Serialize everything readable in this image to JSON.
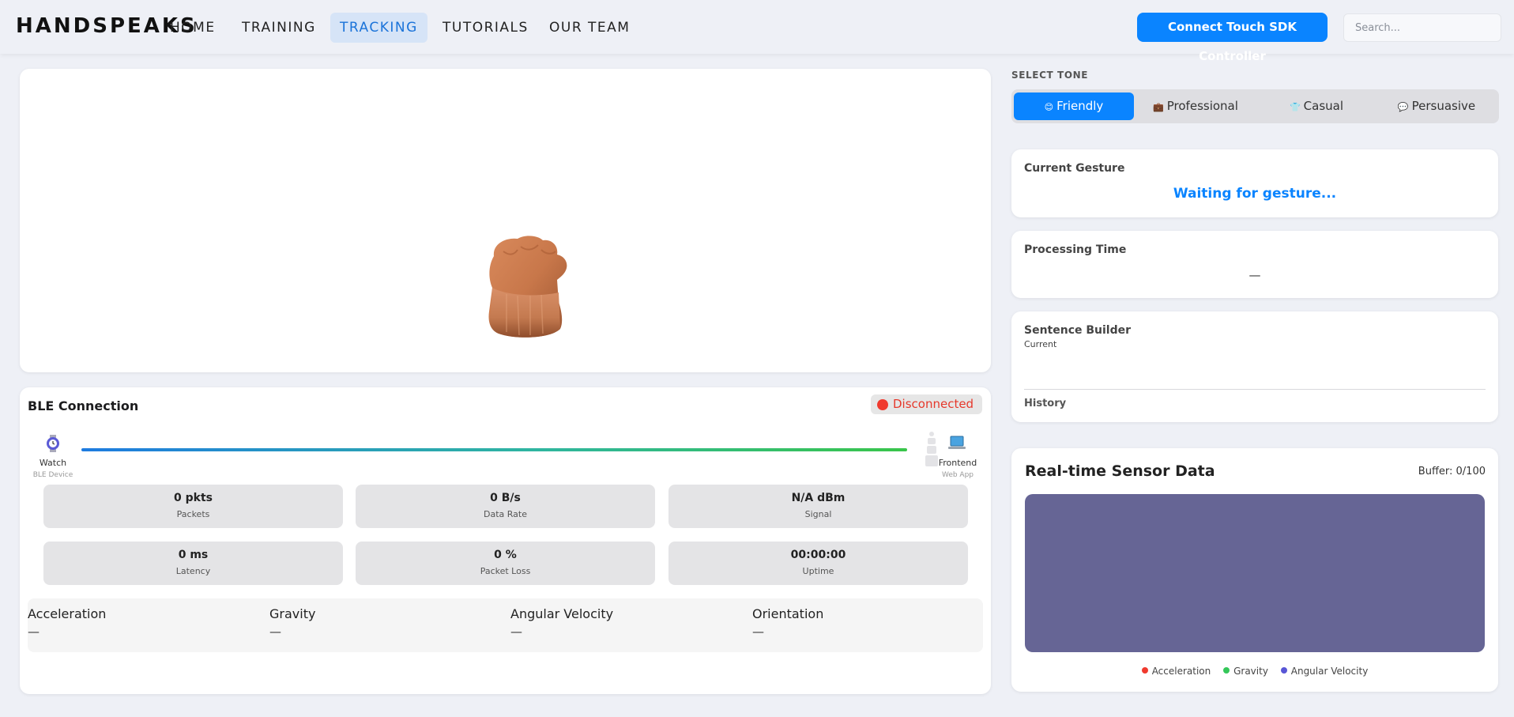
{
  "nav": {
    "brand": "HANDSPEAKS",
    "links": [
      "HOME",
      "TRAINING",
      "TRACKING",
      "TUTORIALS",
      "OUR TEAM"
    ],
    "active_link": "TRACKING",
    "connect_label": "Connect Touch SDK Controller",
    "search_placeholder": "Search..."
  },
  "ble": {
    "title": "BLE Connection",
    "status": "Disconnected",
    "status_color": "#f03a2e",
    "watch": {
      "label": "Watch",
      "sub": "BLE Device",
      "icon": "watch-icon"
    },
    "frontend": {
      "label": "Frontend",
      "sub": "Web App",
      "icon": "laptop-icon"
    },
    "stats": [
      {
        "value": "0 pkts",
        "label": "Packets"
      },
      {
        "value": "0 B/s",
        "label": "Data Rate"
      },
      {
        "value": "N/A dBm",
        "label": "Signal"
      },
      {
        "value": "0 ms",
        "label": "Latency"
      },
      {
        "value": "0 %",
        "label": "Packet Loss"
      },
      {
        "value": "00:00:00",
        "label": "Uptime"
      }
    ],
    "motion": [
      {
        "name": "Acceleration",
        "value": "—"
      },
      {
        "name": "Gravity",
        "value": "—"
      },
      {
        "name": "Angular Velocity",
        "value": "—"
      },
      {
        "name": "Orientation",
        "value": "—"
      }
    ]
  },
  "tone": {
    "label": "SELECT TONE",
    "options": [
      {
        "label": "Friendly",
        "icon": "😊"
      },
      {
        "label": "Professional",
        "icon": "💼"
      },
      {
        "label": "Casual",
        "icon": "👕"
      },
      {
        "label": "Persuasive",
        "icon": "💬"
      }
    ],
    "selected": "Friendly",
    "accent": "#0a84ff"
  },
  "gesture": {
    "title": "Current Gesture",
    "status": "Waiting for gesture..."
  },
  "processing": {
    "title": "Processing Time",
    "value": "—"
  },
  "sentence": {
    "title": "Sentence Builder",
    "current_label": "Current",
    "history_label": "History"
  },
  "sensor": {
    "title": "Real-time Sensor Data",
    "buffer": "Buffer: 0/100",
    "legend": [
      {
        "name": "Acceleration",
        "color": "#f03a2e"
      },
      {
        "name": "Gravity",
        "color": "#34c759"
      },
      {
        "name": "Angular Velocity",
        "color": "#5856d6"
      }
    ]
  }
}
